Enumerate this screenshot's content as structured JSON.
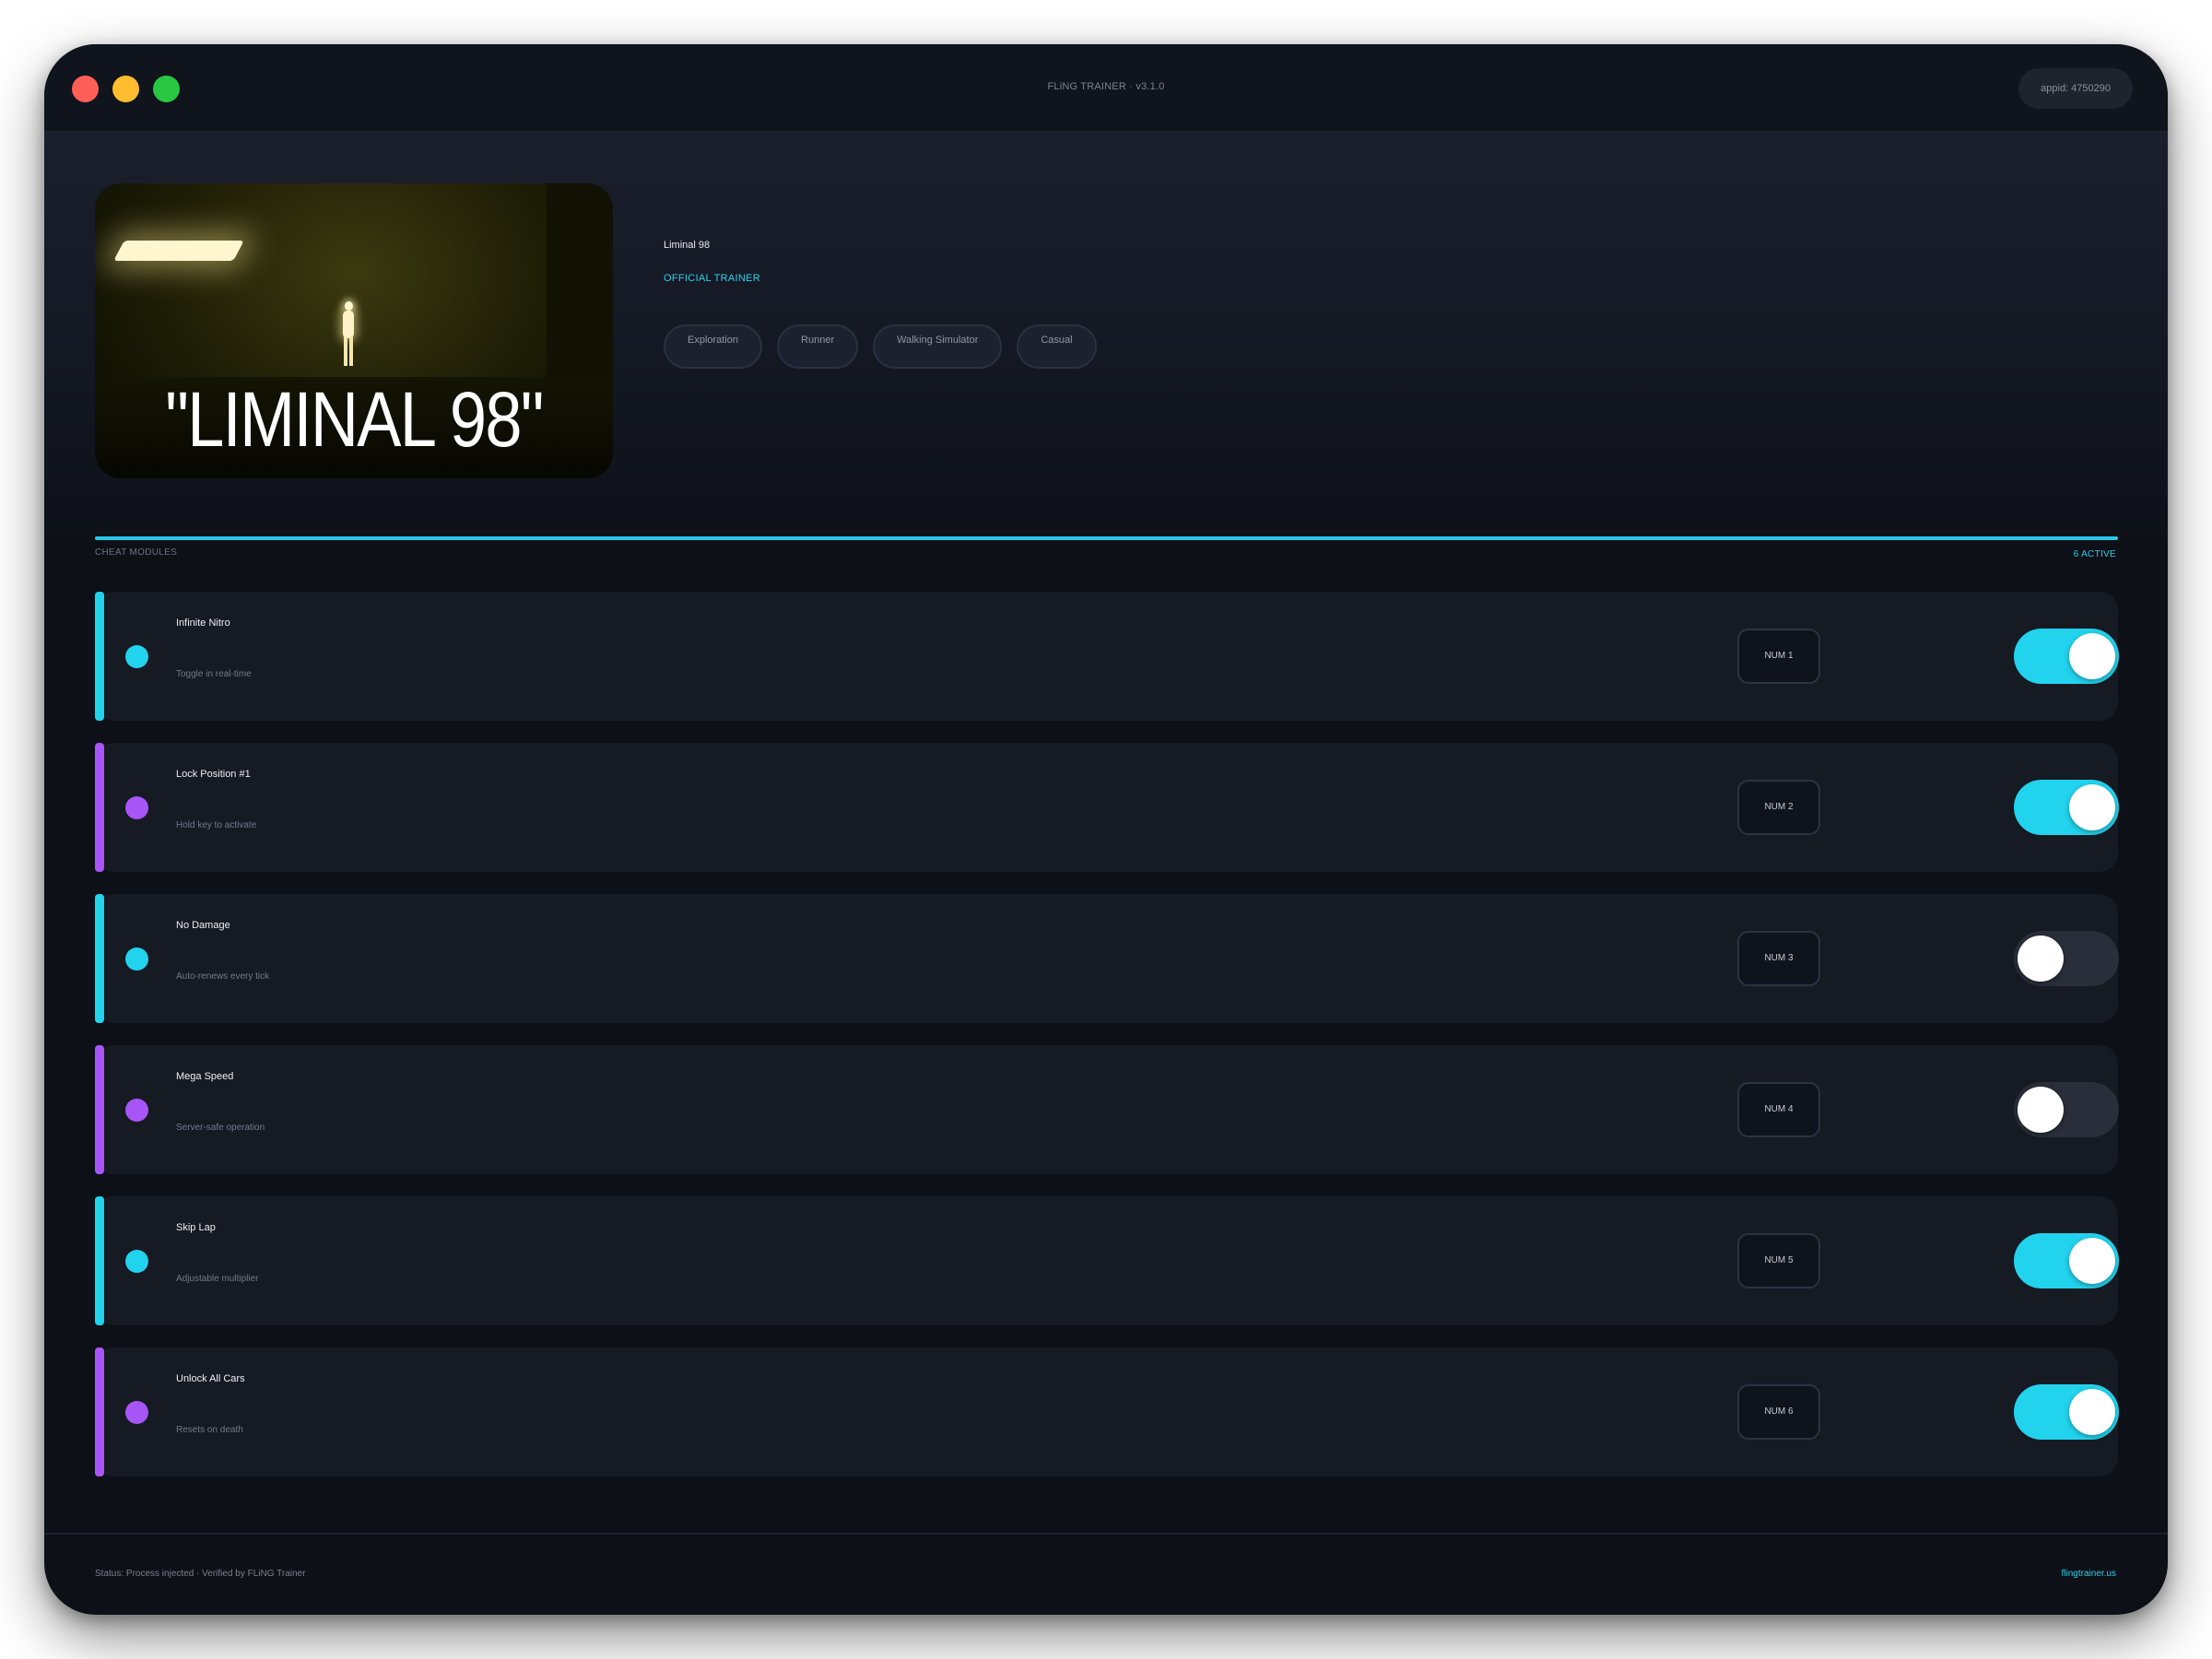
{
  "window": {
    "title": "FLiNG TRAINER · v3.1.0",
    "appid": "appid: 4750290"
  },
  "game": {
    "name": "Liminal 98",
    "cover_title": "\"LIMINAL 98\"",
    "badge": "OFFICIAL TRAINER",
    "tags": [
      "Exploration",
      "Runner",
      "Walking Simulator",
      "Casual"
    ]
  },
  "section": {
    "label": "CHEAT MODULES",
    "active_count": "6 ACTIVE"
  },
  "modules": [
    {
      "name": "Infinite Nitro",
      "desc": "Toggle in real-time",
      "key": "NUM 1",
      "enabled": true,
      "accent": "cyan"
    },
    {
      "name": "Lock Position #1",
      "desc": "Hold key to activate",
      "key": "NUM 2",
      "enabled": true,
      "accent": "purple"
    },
    {
      "name": "No Damage",
      "desc": "Auto-renews every tick",
      "key": "NUM 3",
      "enabled": false,
      "accent": "cyan"
    },
    {
      "name": "Mega Speed",
      "desc": "Server-safe operation",
      "key": "NUM 4",
      "enabled": false,
      "accent": "purple"
    },
    {
      "name": "Skip Lap",
      "desc": "Adjustable multiplier",
      "key": "NUM 5",
      "enabled": true,
      "accent": "cyan"
    },
    {
      "name": "Unlock All Cars",
      "desc": "Resets on death",
      "key": "NUM 6",
      "enabled": true,
      "accent": "purple"
    }
  ],
  "footer": {
    "status": "Status: Process injected · Verified by FLiNG Trainer",
    "link": "flingtrainer.us"
  },
  "colors": {
    "accent_cyan": "#22d3ee",
    "accent_purple": "#a855f7",
    "toggle_off": "#2a2e3a",
    "background": "#0d1017"
  }
}
